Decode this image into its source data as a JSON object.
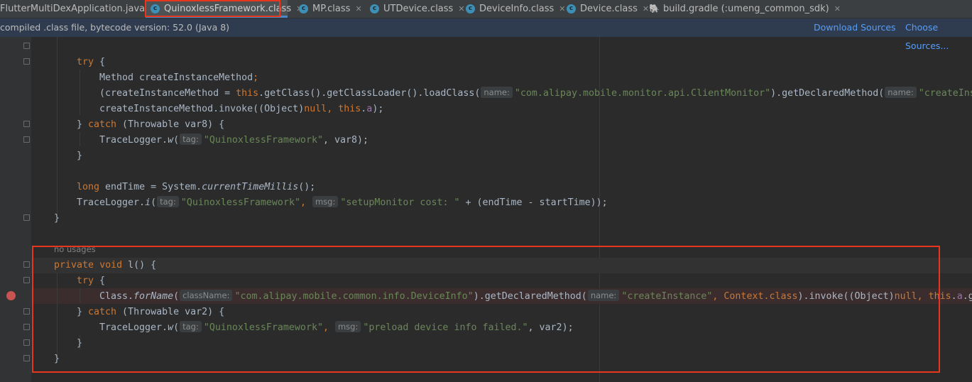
{
  "tabs": [
    {
      "label": "FlutterMultiDexApplication.java",
      "icon": "java-class-icon"
    },
    {
      "label": "QuinoxlessFramework.class",
      "icon": "java-class-icon",
      "active": true
    },
    {
      "label": "MP.class",
      "icon": "java-class-icon"
    },
    {
      "label": "UTDevice.class",
      "icon": "java-class-icon"
    },
    {
      "label": "DeviceInfo.class",
      "icon": "java-class-icon"
    },
    {
      "label": "Device.class",
      "icon": "java-class-icon"
    },
    {
      "label": "build.gradle (:umeng_common_sdk)",
      "icon": "gradle-icon"
    }
  ],
  "info_bar": {
    "message": "compiled .class file, bytecode version: 52.0 (Java 8)",
    "download_sources": "Download Sources",
    "choose_sources": "Choose Sources..."
  },
  "code": {
    "l1_kw": "try",
    "l1_p": " {",
    "l2_a": "Method createInstanceMethod",
    "l2_b": ";",
    "l3_a": "(createInstanceMethod = ",
    "l3_this": "this",
    "l3_b": ".getClass().getClassLoader().loadClass(",
    "l3_hint1": "name:",
    "l3_str1": "\"com.alipay.mobile.monitor.api.ClientMonitor\"",
    "l3_c": ").getDeclaredMethod(",
    "l3_hint2": "name:",
    "l3_str2": "\"createInstance\"",
    "l4_a": "createInstanceMethod.invoke((Object)",
    "l4_null": "null",
    "l4_b": ", ",
    "l4_this": "this",
    "l4_c": ".",
    "l4_field": "a",
    "l4_d": ");",
    "l5_a": "} ",
    "l5_kw": "catch",
    "l5_b": " (Throwable var8) {",
    "l6_a": "TraceLogger.",
    "l6_m": "w",
    "l6_b": "(",
    "l6_hint": "tag:",
    "l6_str": "\"QuinoxlessFramework\"",
    "l6_c": ", var8);",
    "l7": "}",
    "l9_kw": "long",
    "l9_a": " endTime = System.",
    "l9_m": "currentTimeMillis",
    "l9_b": "();",
    "l10_a": "TraceLogger.",
    "l10_m": "i",
    "l10_b": "(",
    "l10_hint1": "tag:",
    "l10_str1": "\"QuinoxlessFramework\"",
    "l10_c": ", ",
    "l10_hint2": "msg:",
    "l10_str2": "\"setupMonitor cost: \"",
    "l10_d": " + (endTime - startTime));",
    "l11": "}",
    "no_usages": "no usages",
    "l13_kw1": "private",
    "l13_sp": " ",
    "l13_kw2": "void",
    "l13_a": " l() {",
    "l14_kw": "try",
    "l14_p": " {",
    "l15_a": "Class.",
    "l15_m": "forName",
    "l15_b": "(",
    "l15_hint1": "className:",
    "l15_str1": "\"com.alipay.mobile.common.info.DeviceInfo\"",
    "l15_c": ").getDeclaredMethod(",
    "l15_hint2": "name:",
    "l15_str2": "\"createInstance\"",
    "l15_d": ", Context.",
    "l15_kw": "class",
    "l15_e": ").invoke((Object)",
    "l15_null": "null",
    "l15_f": ", ",
    "l15_this": "this",
    "l15_g": ".",
    "l15_field": "a",
    "l15_h": ".g",
    "l16_a": "} ",
    "l16_kw": "catch",
    "l16_b": " (Throwable var2) {",
    "l17_a": "TraceLogger.",
    "l17_m": "w",
    "l17_b": "(",
    "l17_hint1": "tag:",
    "l17_str1": "\"QuinoxlessFramework\"",
    "l17_c": ", ",
    "l17_hint2": "msg:",
    "l17_str2": "\"preload device info failed.\"",
    "l17_d": ", var2);",
    "l18": "}",
    "l19": "}"
  },
  "colors": {
    "keyword": "#cc7832",
    "string": "#6a8759",
    "field": "#9876aa",
    "plain": "#a9b7c6",
    "highlight_box": "#e8361d",
    "breakpoint": "#c75450"
  }
}
